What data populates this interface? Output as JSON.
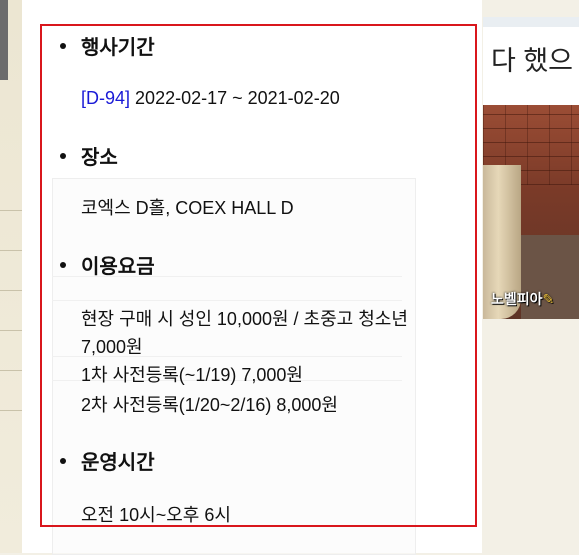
{
  "event": {
    "period": {
      "heading": "행사기간",
      "dday": "[D-94]",
      "dates": "2022-02-17 ~ 2021-02-20"
    },
    "venue": {
      "heading": "장소",
      "text": "코엑스 D홀, COEX HALL D"
    },
    "fees": {
      "heading": "이용요금",
      "lines": [
        "현장 구매 시 성인 10,000원 / 초중고 청소년",
        "7,000원",
        "1차 사전등록(~1/19) 7,000원",
        "2차 사전등록(1/20~2/16) 8,000원"
      ]
    },
    "hours": {
      "heading": "운영시간",
      "text": "오전 10시~오후 6시"
    }
  },
  "ad": {
    "caption": "다 했으",
    "logo_text": "노벨피아",
    "logo_mark": "✎"
  },
  "colors": {
    "highlight_border": "#d9161c",
    "dday_link": "#1a1ad6"
  }
}
